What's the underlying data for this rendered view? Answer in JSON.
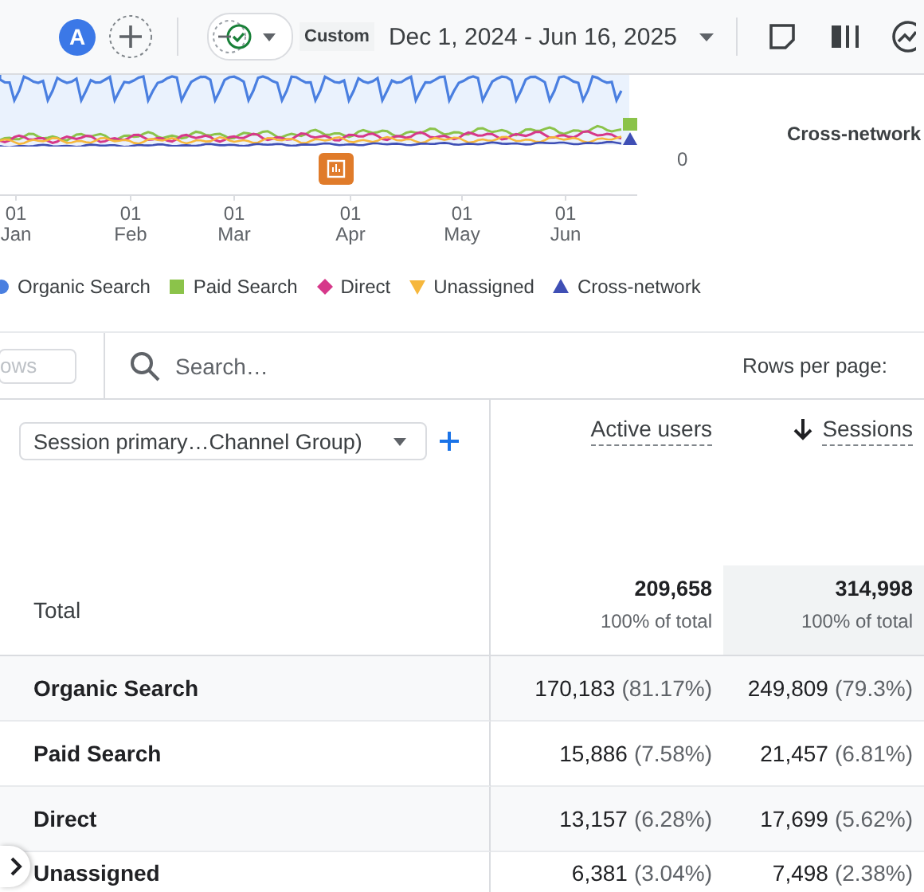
{
  "topbar": {
    "avatar": "A",
    "comparison_label": "Custom",
    "date_range": "Dec 1, 2024 - Jun 16, 2025"
  },
  "chart": {
    "series_label": "Cross-network",
    "y_label": "0",
    "x_labels": [
      {
        "day": "01",
        "month": "Jan"
      },
      {
        "day": "01",
        "month": "Feb"
      },
      {
        "day": "01",
        "month": "Mar"
      },
      {
        "day": "01",
        "month": "Apr"
      },
      {
        "day": "01",
        "month": "May"
      },
      {
        "day": "01",
        "month": "Jun"
      }
    ],
    "legend": [
      {
        "label": "Organic Search",
        "color": "#4a7fe0",
        "kind": "circle"
      },
      {
        "label": "Paid Search",
        "color": "#8bc34a",
        "kind": "square"
      },
      {
        "label": "Direct",
        "color": "#d6388a",
        "kind": "diamond"
      },
      {
        "label": "Unassigned",
        "color": "#f6b73c",
        "kind": "triangle-down"
      },
      {
        "label": "Cross-network",
        "color": "#3f4fb5",
        "kind": "triangle-up"
      }
    ]
  },
  "toolbar": {
    "filter_placeholder": "ows",
    "search_placeholder": "Search…",
    "rows_per_page_label": "Rows per page:"
  },
  "table": {
    "dimension": "Session primary…Channel Group)",
    "columns": [
      {
        "label": "Active users",
        "sorted": false
      },
      {
        "label": "Sessions",
        "sorted": true
      }
    ],
    "total": {
      "label": "Total",
      "values": [
        {
          "value": "209,658",
          "share": "100% of total"
        },
        {
          "value": "314,998",
          "share": "100% of total"
        }
      ]
    },
    "rows": [
      {
        "label": "Organic Search",
        "values": [
          {
            "value": "170,183",
            "pct": "(81.17%)"
          },
          {
            "value": "249,809",
            "pct": "(79.3%)"
          }
        ]
      },
      {
        "label": "Paid Search",
        "values": [
          {
            "value": "15,886",
            "pct": "(7.58%)"
          },
          {
            "value": "21,457",
            "pct": "(6.81%)"
          }
        ]
      },
      {
        "label": "Direct",
        "values": [
          {
            "value": "13,157",
            "pct": "(6.28%)"
          },
          {
            "value": "17,699",
            "pct": "(5.62%)"
          }
        ]
      },
      {
        "label": "Unassigned",
        "values": [
          {
            "value": "6,381",
            "pct": "(3.04%)"
          },
          {
            "value": "7,498",
            "pct": "(2.38%)"
          }
        ]
      }
    ]
  }
}
